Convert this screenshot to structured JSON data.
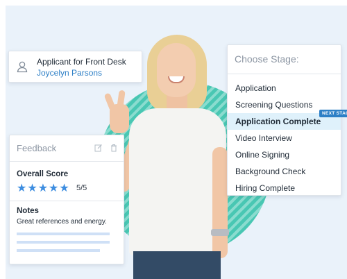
{
  "applicant": {
    "role": "Applicant for Front Desk",
    "name": "Joycelyn Parsons",
    "icon": "user-icon"
  },
  "stage_picker": {
    "title": "Choose Stage:",
    "stages": [
      "Application",
      "Screening Questions",
      "Application Complete",
      "Video Interview",
      "Online Signing",
      "Background Check",
      "Hiring Complete"
    ],
    "active_stage": "Application Complete",
    "badge": "NEXT STAGE"
  },
  "feedback": {
    "title": "Feedback",
    "icons": [
      "edit-icon",
      "trash-icon"
    ],
    "score_label": "Overall Score",
    "stars": "★★★★★",
    "rating": 5,
    "rating_max": 5,
    "score_text": "5/5",
    "notes_label": "Notes",
    "notes_text": "Great references and energy."
  },
  "colors": {
    "accent": "#2d7fc6",
    "star": "#3d8de0",
    "active_row": "#dff1fb",
    "teal": "#49c7b3"
  }
}
